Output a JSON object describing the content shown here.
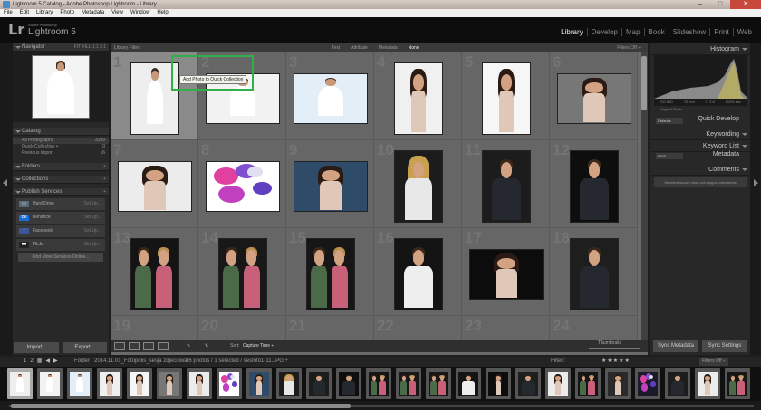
{
  "window": {
    "title": "Lightroom 5 Catalog - Adobe Photoshop Lightroom - Library",
    "controls": [
      "–",
      "□",
      "✕"
    ]
  },
  "menu": [
    "File",
    "Edit",
    "Library",
    "Photo",
    "Metadata",
    "View",
    "Window",
    "Help"
  ],
  "identity": {
    "logo": "Lr",
    "adobe": "Adobe Photoshop",
    "product": "Lightroom 5"
  },
  "modules": [
    {
      "label": "Library",
      "active": true
    },
    {
      "label": "Develop",
      "active": false
    },
    {
      "label": "Map",
      "active": false
    },
    {
      "label": "Book",
      "active": false
    },
    {
      "label": "Slideshow",
      "active": false
    },
    {
      "label": "Print",
      "active": false
    },
    {
      "label": "Web",
      "active": false
    }
  ],
  "left_panel": {
    "navigator": {
      "title": "Navigator",
      "zoom_options": "FIT   FILL   1:1   3:1"
    },
    "catalog": {
      "title": "Catalog",
      "items": [
        {
          "label": "All Photographs",
          "count": "3199"
        },
        {
          "label": "Quick Collection +",
          "count": "0"
        },
        {
          "label": "Previous Import",
          "count": "16"
        }
      ]
    },
    "folders": {
      "title": "Folders",
      "action": "+"
    },
    "collections": {
      "title": "Collections",
      "action": "+"
    },
    "publish": {
      "title": "Publish Services",
      "action": "+",
      "services": [
        {
          "label": "Hard Drive",
          "setup": "Set Up...",
          "icon": "hard-drive-icon",
          "color": "#5a6a7a",
          "glyph": "▭"
        },
        {
          "label": "Behance",
          "setup": "Set Up...",
          "icon": "behance-icon",
          "color": "#1a6bd8",
          "glyph": "Bē"
        },
        {
          "label": "Facebook",
          "setup": "Set Up...",
          "icon": "facebook-icon",
          "color": "#3b5998",
          "glyph": "f"
        },
        {
          "label": "Flickr",
          "setup": "Set Up...",
          "icon": "flickr-icon",
          "color": "#222222",
          "glyph": "●●"
        }
      ],
      "find_more": "Find More Services Online..."
    },
    "import_label": "Import...",
    "export_label": "Export..."
  },
  "filter_bar": {
    "label": "Library Filter :",
    "tabs": [
      {
        "label": "Text",
        "active": false
      },
      {
        "label": "Attribute",
        "active": false
      },
      {
        "label": "Metadata",
        "active": false
      },
      {
        "label": "None",
        "active": true
      }
    ],
    "filters_off": "Filters Off ÷"
  },
  "tooltip": "Add Photo to Quick Collection",
  "grid": {
    "cells": [
      {
        "number": "1",
        "kind": "bride",
        "orientation": "portrait",
        "bg": "#eeeeee",
        "selected": true
      },
      {
        "number": "2",
        "kind": "bride",
        "orientation": "landscape",
        "bg": "#f2f2f2",
        "selected": false
      },
      {
        "number": "3",
        "kind": "bride",
        "orientation": "landscape",
        "bg": "#e4eef6",
        "selected": false
      },
      {
        "number": "4",
        "kind": "woman",
        "orientation": "portrait",
        "bg": "#f0f0f0",
        "selected": false
      },
      {
        "number": "5",
        "kind": "woman",
        "orientation": "portrait",
        "bg": "#f6f6f6",
        "selected": false
      },
      {
        "number": "6",
        "kind": "woman",
        "orientation": "landscape",
        "bg": "#777777",
        "selected": false
      },
      {
        "number": "7",
        "kind": "woman",
        "orientation": "landscape",
        "bg": "#ececec",
        "selected": false
      },
      {
        "number": "8",
        "kind": "balloons",
        "orientation": "landscape",
        "bg": "#ffffff",
        "selected": false
      },
      {
        "number": "9",
        "kind": "woman",
        "orientation": "landscape",
        "bg": "#2e4c6a",
        "selected": false
      },
      {
        "number": "10",
        "kind": "blonde",
        "orientation": "portrait",
        "bg": "#1c1c1c",
        "selected": false
      },
      {
        "number": "11",
        "kind": "man",
        "orientation": "portrait",
        "bg": "#1c1c1c",
        "selected": false
      },
      {
        "number": "12",
        "kind": "man",
        "orientation": "portrait",
        "bg": "#0e0e0e",
        "selected": false
      },
      {
        "number": "13",
        "kind": "couple",
        "orientation": "portrait",
        "bg": "#141414",
        "selected": false
      },
      {
        "number": "14",
        "kind": "couple",
        "orientation": "portrait",
        "bg": "#181818",
        "selected": false
      },
      {
        "number": "15",
        "kind": "couple",
        "orientation": "portrait",
        "bg": "#161616",
        "selected": false
      },
      {
        "number": "16",
        "kind": "man-white",
        "orientation": "portrait",
        "bg": "#141414",
        "selected": false
      },
      {
        "number": "17",
        "kind": "woman",
        "orientation": "landscape",
        "bg": "#0c0c0c",
        "selected": false
      },
      {
        "number": "18",
        "kind": "man",
        "orientation": "portrait",
        "bg": "#1e1e1e",
        "selected": false
      },
      {
        "number": "19",
        "kind": "partial",
        "orientation": "landscape",
        "bg": "#2e2e2e",
        "selected": false
      },
      {
        "number": "20",
        "kind": "partial",
        "orientation": "landscape",
        "bg": "#2a2a2a",
        "selected": false
      },
      {
        "number": "21",
        "kind": "empty",
        "orientation": "landscape",
        "bg": "#666666",
        "selected": false
      },
      {
        "number": "22",
        "kind": "empty",
        "orientation": "landscape",
        "bg": "#666666",
        "selected": false
      },
      {
        "number": "23",
        "kind": "empty",
        "orientation": "landscape",
        "bg": "#666666",
        "selected": false
      },
      {
        "number": "24",
        "kind": "empty",
        "orientation": "landscape",
        "bg": "#666666",
        "selected": false
      }
    ]
  },
  "toolbar": {
    "sort_label": "Sort:",
    "sort_value": "Capture Time ÷",
    "thumbnails_label": "Thumbnails"
  },
  "right_panel": {
    "histogram": {
      "title": "Histogram",
      "info": [
        "ISO 800",
        "70 mm",
        "f / 2.8",
        "1/200 sec"
      ],
      "original_photo": "Original Photo"
    },
    "quick_develop": {
      "title": "Quick Develop",
      "preset": "Defaults"
    },
    "keywording": {
      "title": "Keywording"
    },
    "keyword_list": {
      "title": "Keyword List"
    },
    "metadata": {
      "title": "Metadata",
      "preset": "EXIF"
    },
    "comments": {
      "title": "Comments",
      "note": "Selected source does not support comments"
    },
    "sync_metadata": "Sync Metadata",
    "sync_settings": "Sync Settings"
  },
  "filmstrip_bar": {
    "pages": [
      "1",
      "2"
    ],
    "folder": "Folder : 2014.11.01_Fotopolis_sesja zdjeciowa",
    "stats": "16 photos / 1 selected / sesfoto1-11.JPG ÷",
    "filter_label": "Filter :",
    "stars": "★★★★★",
    "filters_off": "Filters Off ÷"
  },
  "filmstrip": [
    {
      "bg": "#eeeeee",
      "kind": "bride",
      "selected": true
    },
    {
      "bg": "#f2f2f2",
      "kind": "bride",
      "selected": false
    },
    {
      "bg": "#e4eef6",
      "kind": "bride",
      "selected": false
    },
    {
      "bg": "#f0f0f0",
      "kind": "woman",
      "selected": false
    },
    {
      "bg": "#f6f6f6",
      "kind": "woman",
      "selected": false
    },
    {
      "bg": "#777777",
      "kind": "woman",
      "selected": false
    },
    {
      "bg": "#ececec",
      "kind": "woman",
      "selected": false
    },
    {
      "bg": "#ffffff",
      "kind": "balloons",
      "selected": false
    },
    {
      "bg": "#2e4c6a",
      "kind": "woman",
      "selected": false
    },
    {
      "bg": "#1c1c1c",
      "kind": "blonde",
      "selected": false
    },
    {
      "bg": "#1c1c1c",
      "kind": "man",
      "selected": false
    },
    {
      "bg": "#0e0e0e",
      "kind": "man",
      "selected": false
    },
    {
      "bg": "#141414",
      "kind": "couple",
      "selected": false
    },
    {
      "bg": "#181818",
      "kind": "couple",
      "selected": false
    },
    {
      "bg": "#161616",
      "kind": "couple",
      "selected": false
    },
    {
      "bg": "#141414",
      "kind": "man-white",
      "selected": false
    },
    {
      "bg": "#0c0c0c",
      "kind": "woman",
      "selected": false
    },
    {
      "bg": "#1e1e1e",
      "kind": "man",
      "selected": false
    },
    {
      "bg": "#ececec",
      "kind": "woman",
      "selected": false
    },
    {
      "bg": "#141414",
      "kind": "couple",
      "selected": false
    },
    {
      "bg": "#2a2a2a",
      "kind": "woman",
      "selected": false
    },
    {
      "bg": "#1a1a2a",
      "kind": "balloons",
      "selected": false
    },
    {
      "bg": "#1c1c1c",
      "kind": "man",
      "selected": false
    },
    {
      "bg": "#ececec",
      "kind": "woman",
      "selected": false
    },
    {
      "bg": "#161616",
      "kind": "couple",
      "selected": false
    }
  ]
}
